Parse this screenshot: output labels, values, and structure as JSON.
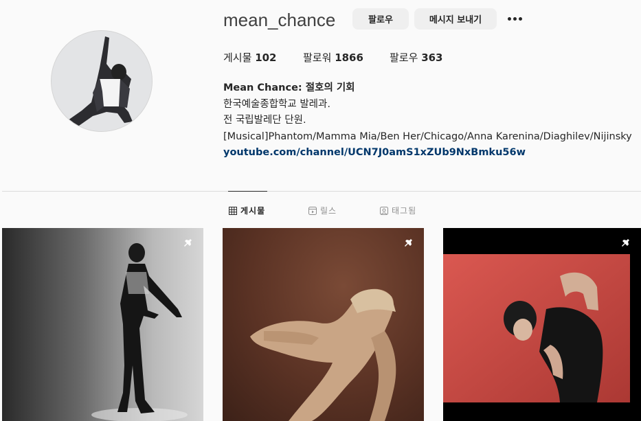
{
  "profile": {
    "username": "mean_chance",
    "follow_label": "팔로우",
    "message_label": "메시지 보내기",
    "more_icon": "more-options-icon"
  },
  "stats": {
    "posts_label": "게시물",
    "posts_value": "102",
    "followers_label": "팔로워",
    "followers_value": "1866",
    "following_label": "팔로우",
    "following_value": "363"
  },
  "bio": {
    "name": "Mean Chance: 절호의 기회",
    "line1": "한국예술종합학교 발레과.",
    "line2": "전 국립발레단 단원.",
    "line3": "[Musical]Phantom/Mamma Mia/Ben Her/Chicago/Anna Karenina/Diaghilev/Nijinsky",
    "link": "youtube.com/channel/UCN7J0amS1xZUb9NxBmku56w"
  },
  "tabs": [
    {
      "label": "게시물",
      "icon": "grid-icon",
      "active": true
    },
    {
      "label": "릴스",
      "icon": "reels-icon",
      "active": false
    },
    {
      "label": "태그됨",
      "icon": "tagged-icon",
      "active": false
    }
  ],
  "posts": [
    {
      "pinned": true,
      "icon": "pin-icon"
    },
    {
      "pinned": true,
      "icon": "pin-icon"
    },
    {
      "pinned": true,
      "icon": "pin-icon"
    }
  ],
  "colors": {
    "link": "#00376b",
    "button_bg": "#efefef",
    "background": "#fafafa"
  }
}
